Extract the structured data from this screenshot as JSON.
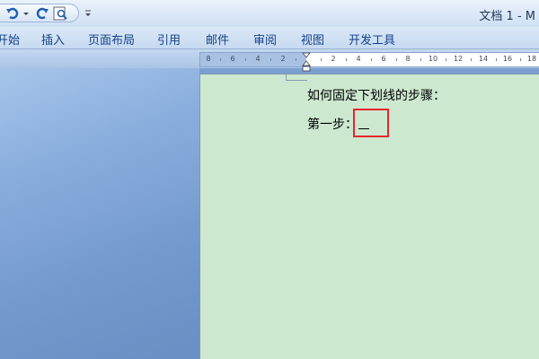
{
  "window": {
    "title": "文档 1 - M"
  },
  "ribbon": {
    "tabs": [
      "开始",
      "插入",
      "页面布局",
      "引用",
      "邮件",
      "审阅",
      "视图",
      "开发工具"
    ]
  },
  "ruler": {
    "left_ticks": [
      "8",
      "6",
      "4",
      "2"
    ],
    "right_ticks": [
      "2",
      "4",
      "6",
      "8",
      "10",
      "12",
      "14",
      "16",
      "18"
    ]
  },
  "document": {
    "line1": "如何固定下划线的步骤：",
    "line2": "第一步："
  },
  "colors": {
    "page_background": "#cce8cf",
    "highlight_border": "#e8262c",
    "tab_text": "#15428b"
  }
}
